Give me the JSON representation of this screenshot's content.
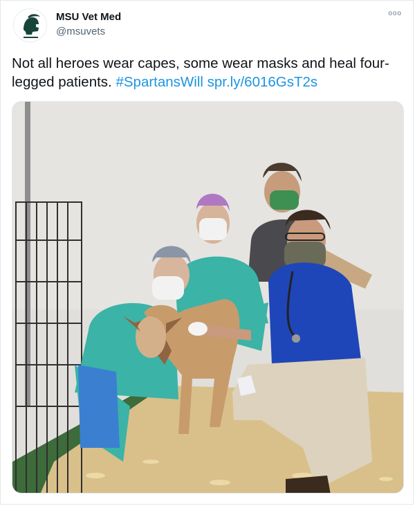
{
  "author": {
    "display_name": "MSU Vet Med",
    "handle": "@msuvets",
    "avatar_icon": "spartan-helmet-icon"
  },
  "more_menu": {
    "label": "ooo",
    "icon": "more-options-icon"
  },
  "tweet": {
    "text": "Not all heroes wear capes, some wear masks and heal four-legged patients.",
    "hashtag": "#SpartansWill",
    "link": "spr.ly/6016GsT2s"
  },
  "media": {
    "type": "photo",
    "subject": "four masked veterinary staff kneeling around a goat on wood shavings"
  },
  "colors": {
    "link": "#1b95e0",
    "brand_green": "#18453b",
    "text": "#0f1419",
    "secondary": "#536471"
  }
}
